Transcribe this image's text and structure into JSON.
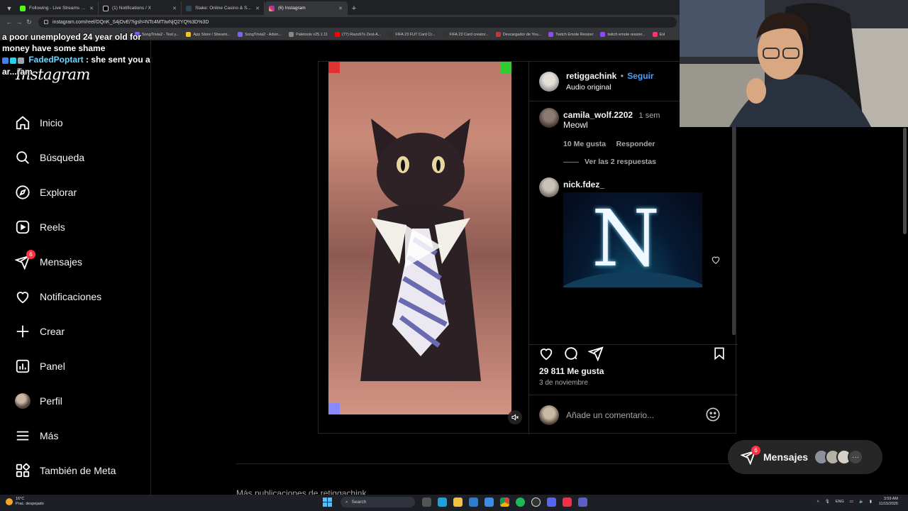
{
  "browser": {
    "tabs": [
      {
        "title": "Following - Live Streams on Ki",
        "color": "#53fc18",
        "active": false
      },
      {
        "title": "(1) Notifications / X",
        "color": "#ffffff",
        "active": false
      },
      {
        "title": "Stake: Online Casino & Sports",
        "color": "#1a2c38",
        "active": false
      },
      {
        "title": "(6) Instagram",
        "color": "#e1306c",
        "active": true
      }
    ],
    "url": "instagram.com/reel/DQnK_S4jOvE/?igsh=NTc4MTIwNjQ2YQ%3D%3D",
    "bookmarks": [
      {
        "label": "SongTrivia2 - Test y...",
        "color": "#7b61ff"
      },
      {
        "label": "App Store / Streami...",
        "color": "#f5c518"
      },
      {
        "label": "SongTrivia2 - Advin...",
        "color": "#7b61ff"
      },
      {
        "label": "Paletools v25.1.11",
        "color": "#888888"
      },
      {
        "label": "(77) Razo97s Zest-A...",
        "color": "#ff0000"
      },
      {
        "label": "FIFA 23 FUT Card Cr...",
        "color": "#333333"
      },
      {
        "label": "FIFA 23 Card creator...",
        "color": "#333333"
      },
      {
        "label": "Descargador de You...",
        "color": "#cc3333"
      },
      {
        "label": "Twitch Emote Resizer",
        "color": "#9146ff"
      },
      {
        "label": "twitch emote resizer...",
        "color": "#9146ff"
      },
      {
        "label": "Esl",
        "color": "#ff3366"
      }
    ]
  },
  "chat": {
    "line1": "a poor unemployed 24 year old for money have some shame",
    "user": "FadedPoptart",
    "message": ": she sent you a ar...ram"
  },
  "sidebar": {
    "logo": "Instagram",
    "items": [
      {
        "label": "Inicio",
        "icon": "home-icon"
      },
      {
        "label": "Búsqueda",
        "icon": "search-icon"
      },
      {
        "label": "Explorar",
        "icon": "compass-icon"
      },
      {
        "label": "Reels",
        "icon": "reels-icon"
      },
      {
        "label": "Mensajes",
        "icon": "messenger-icon",
        "badge": "6"
      },
      {
        "label": "Notificaciones",
        "icon": "heart-icon"
      },
      {
        "label": "Crear",
        "icon": "plus-icon"
      },
      {
        "label": "Panel",
        "icon": "dashboard-icon"
      },
      {
        "label": "Perfil",
        "icon": "profile-avatar"
      },
      {
        "label": "Más",
        "icon": "menu-icon"
      },
      {
        "label": "También de Meta",
        "icon": "meta-grid-icon"
      }
    ]
  },
  "post": {
    "author": "retiggachink",
    "separator": "•",
    "follow": "Seguir",
    "audio": "Audio original",
    "comments": [
      {
        "user": "camila_wolf.2202",
        "time": "1 sem",
        "text": "Meowl",
        "likes": "10 Me gusta",
        "reply": "Responder",
        "view_replies": "Ver las 2 respuestas"
      },
      {
        "user": "nick.fdez_",
        "gif_letter": "N"
      }
    ],
    "likes": "29 811 Me gusta",
    "date": "3 de noviembre",
    "comment_placeholder": "Añade un comentario...",
    "more_from": "Más publicaciones de retiggachink"
  },
  "messages_pill": {
    "label": "Mensajes",
    "badge": "6",
    "more": "···"
  },
  "taskbar": {
    "weather_temp": "16°C",
    "weather_desc": "Prac. despejado",
    "search": "Search",
    "lang": "ENG",
    "time": "3:59 AM",
    "date": "11/15/2025"
  },
  "colors": {
    "accent_blue": "#4ca0ff",
    "badge_red": "#ff3040",
    "chat_user": "#6fd3ff"
  }
}
